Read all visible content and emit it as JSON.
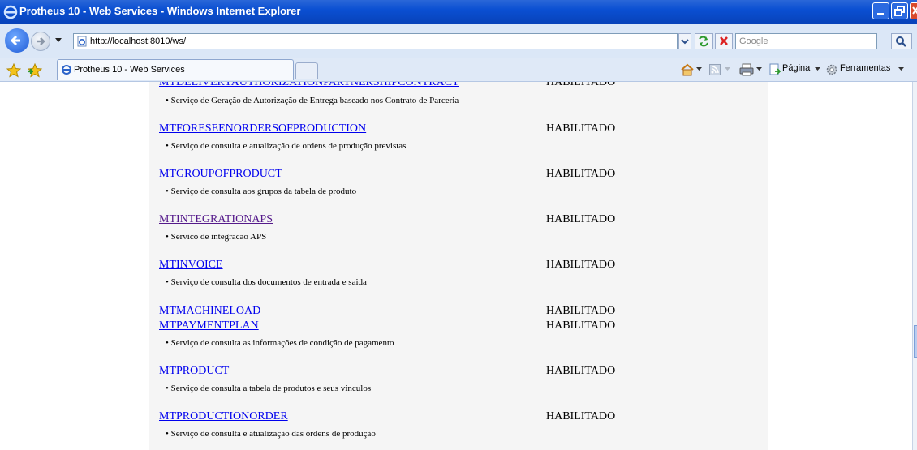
{
  "window": {
    "title": "Protheus 10 - Web Services - Windows Internet Explorer"
  },
  "address": {
    "url": "http://localhost:8010/ws/",
    "search_placeholder": "Google"
  },
  "tab": {
    "label": "Protheus 10 - Web Services"
  },
  "commandbar": {
    "page_label": "Página",
    "tools_label": "Ferramentas"
  },
  "services": [
    {
      "name": "MTDELIVERYAUTHORIZATIONPARTNERSHIPCONTRACT",
      "status": "HABILITADO",
      "description": "• Serviço de Geração de Autorização de Entrega baseado nos Contrato de Parceria"
    },
    {
      "name": "MTFORESEENORDERSOFPRODUCTION",
      "status": "HABILITADO",
      "description": "• Serviço de consulta e atualização de ordens de produção previstas"
    },
    {
      "name": "MTGROUPOFPRODUCT",
      "status": "HABILITADO",
      "description": "• Serviço de consulta aos grupos da tabela de produto"
    },
    {
      "name": "MTINTEGRATIONAPS",
      "status": "HABILITADO",
      "description": "• Servico de integracao APS"
    },
    {
      "name": "MTINVOICE",
      "status": "HABILITADO",
      "description": "• Serviço de consulta dos documentos de entrada e saida"
    },
    {
      "name": "MTMACHINELOAD",
      "status": "HABILITADO",
      "description": ""
    },
    {
      "name": "MTPAYMENTPLAN",
      "status": "HABILITADO",
      "description": "• Serviço de consulta as informações de condição de pagamento"
    },
    {
      "name": "MTPRODUCT",
      "status": "HABILITADO",
      "description": "• Serviço de consulta a tabela de produtos e seus vinculos"
    },
    {
      "name": "MTPRODUCTIONORDER",
      "status": "HABILITADO",
      "description": "• Serviço de consulta e atualização das ordens de produção"
    }
  ]
}
